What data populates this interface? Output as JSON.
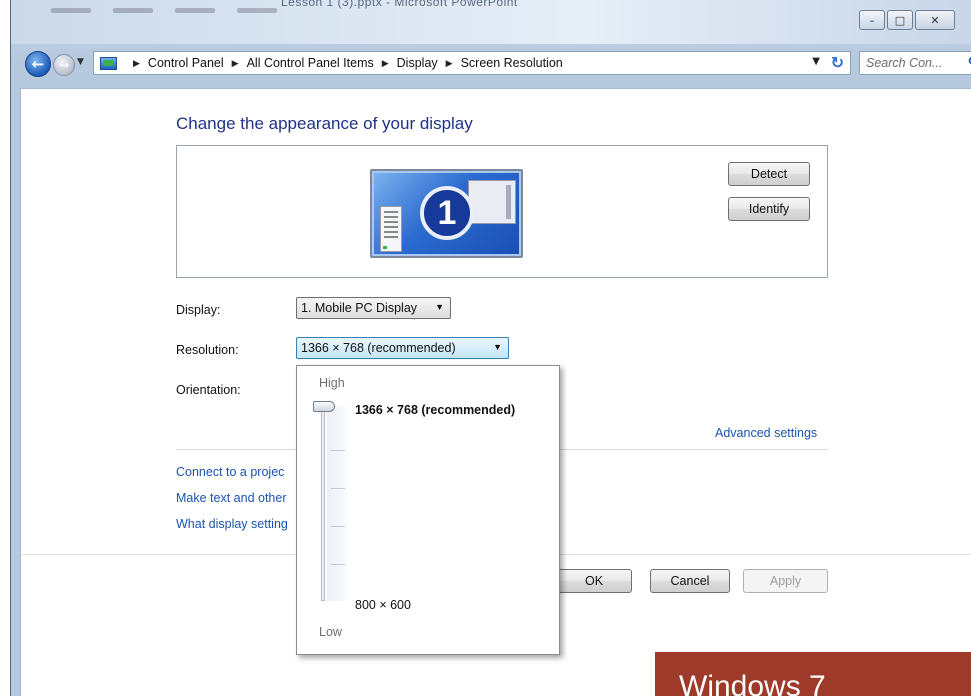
{
  "window": {
    "title": "Lesson 1 (3).pptx - Microsoft PowerPoint",
    "controls": {
      "minimize": "–",
      "maximize": "□",
      "close": "✕"
    }
  },
  "nav": {
    "back_icon": "←",
    "forward_icon": "→",
    "breadcrumbs": [
      "Control Panel",
      "All Control Panel Items",
      "Display",
      "Screen Resolution"
    ],
    "search_placeholder": "Search Con..."
  },
  "content": {
    "heading": "Change the appearance of your display",
    "monitor_number": "1",
    "detect_label": "Detect",
    "identify_label": "Identify",
    "display_label": "Display:",
    "display_value": "1. Mobile PC Display",
    "resolution_label": "Resolution:",
    "resolution_value": "1366 × 768 (recommended)",
    "orientation_label": "Orientation:",
    "advanced_settings": "Advanced settings",
    "links": [
      "Connect to a projec",
      "Make text and other",
      "What display setting"
    ],
    "ok_label": "OK",
    "cancel_label": "Cancel",
    "apply_label": "Apply"
  },
  "resolution_popup": {
    "high_label": "High",
    "low_label": "Low",
    "top_value": "1366 × 768 (recommended)",
    "bottom_value": "800 × 600",
    "selected_level": 1.0
  },
  "watermark": {
    "text": "Windows 7"
  },
  "colors": {
    "heading": "#1e3287",
    "link": "#1a53b0",
    "watermark_bg": "#9e3a2a"
  }
}
